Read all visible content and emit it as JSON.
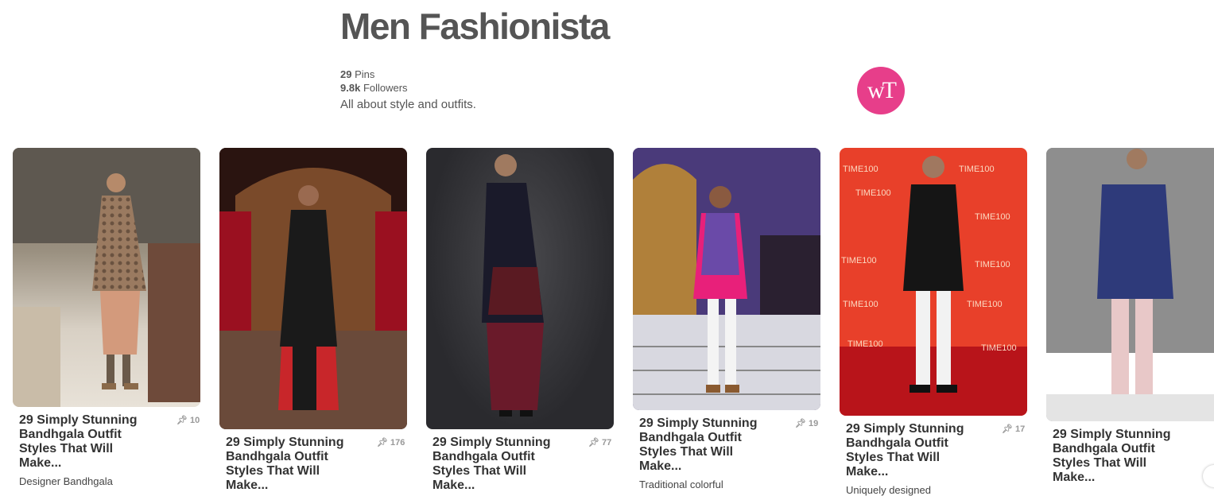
{
  "board": {
    "title": "Men Fashionista",
    "pins_count": "29",
    "pins_label": "Pins",
    "followers_count": "9.8k",
    "followers_label": "Followers",
    "description": "All about style and outfits.",
    "logo_text": "wT"
  },
  "pins": [
    {
      "title": "29 Simply Stunning Bandhgala Outfit Styles That Will Make...",
      "repins": "10",
      "desc": "Designer Bandhgala"
    },
    {
      "title": "29 Simply Stunning Bandhgala Outfit Styles That Will Make...",
      "repins": "176",
      "desc": ""
    },
    {
      "title": "29 Simply Stunning Bandhgala Outfit Styles That Will Make...",
      "repins": "77",
      "desc": ""
    },
    {
      "title": "29 Simply Stunning Bandhgala Outfit Styles That Will Make...",
      "repins": "19",
      "desc": "Traditional colorful"
    },
    {
      "title": "29 Simply Stunning Bandhgala Outfit Styles That Will Make...",
      "repins": "17",
      "desc": "Uniquely designed"
    },
    {
      "title": "29 Simply Stunning Bandhgala Outfit Styles That Will Make...",
      "repins": "",
      "desc": ""
    }
  ],
  "icons": {
    "repin": "pin-icon",
    "logo": "wt-logo"
  },
  "colors": {
    "logo_bg": "#e73e8a",
    "title": "#555555"
  }
}
